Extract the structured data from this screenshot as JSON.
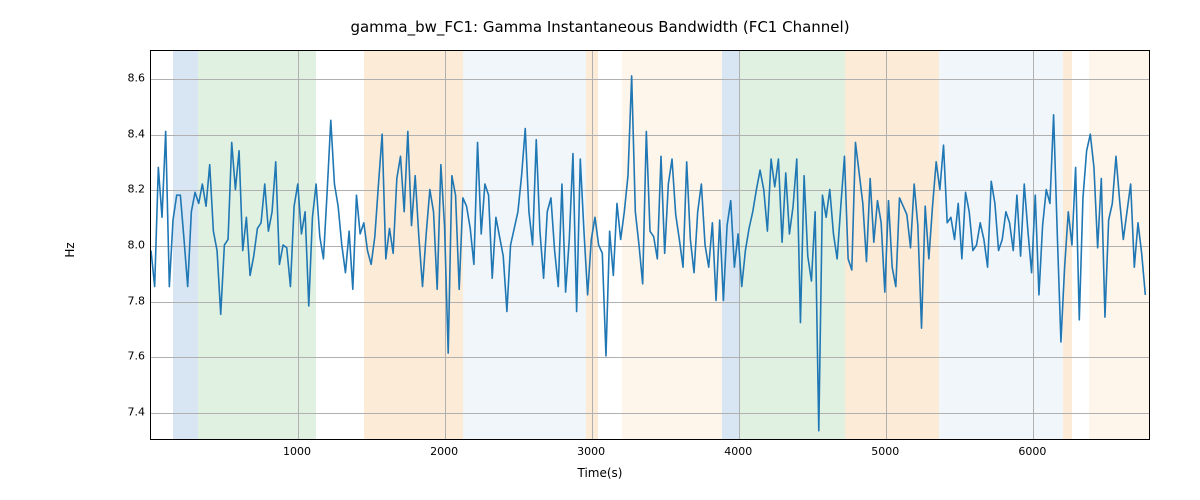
{
  "chart_data": {
    "type": "line",
    "title": "gamma_bw_FC1: Gamma Instantaneous Bandwidth (FC1 Channel)",
    "xlabel": "Time(s)",
    "ylabel": "Hz",
    "xlim": [
      0,
      6800
    ],
    "ylim": [
      7.3,
      8.7
    ],
    "xticks": [
      1000,
      2000,
      3000,
      4000,
      5000,
      6000
    ],
    "yticks": [
      7.4,
      7.6,
      7.8,
      8.0,
      8.2,
      8.4,
      8.6
    ],
    "line_color": "#1f77b4",
    "bands": [
      {
        "x0": 150,
        "x1": 320,
        "color": "#8db7d9"
      },
      {
        "x0": 320,
        "x1": 1120,
        "color": "#a8d8a8"
      },
      {
        "x0": 1450,
        "x1": 2120,
        "color": "#f5c58b"
      },
      {
        "x0": 2120,
        "x1": 2960,
        "color": "#d7e5f2"
      },
      {
        "x0": 2960,
        "x1": 3040,
        "color": "#f5c58b"
      },
      {
        "x0": 3200,
        "x1": 3880,
        "color": "#fbe2c5"
      },
      {
        "x0": 3880,
        "x1": 4000,
        "color": "#8db7d9"
      },
      {
        "x0": 4000,
        "x1": 4720,
        "color": "#a8d8a8"
      },
      {
        "x0": 4720,
        "x1": 5360,
        "color": "#f5c58b"
      },
      {
        "x0": 5360,
        "x1": 6200,
        "color": "#d7e5f2"
      },
      {
        "x0": 6200,
        "x1": 6260,
        "color": "#f5c58b"
      },
      {
        "x0": 6380,
        "x1": 6800,
        "color": "#fbe2c5"
      }
    ],
    "x": [
      0,
      25,
      50,
      75,
      100,
      125,
      150,
      175,
      200,
      225,
      250,
      275,
      300,
      325,
      350,
      375,
      400,
      425,
      450,
      475,
      500,
      525,
      550,
      575,
      600,
      625,
      650,
      675,
      700,
      725,
      750,
      775,
      800,
      825,
      850,
      875,
      900,
      925,
      950,
      975,
      1000,
      1025,
      1050,
      1075,
      1100,
      1125,
      1150,
      1175,
      1200,
      1225,
      1250,
      1275,
      1300,
      1325,
      1350,
      1375,
      1400,
      1425,
      1450,
      1475,
      1500,
      1525,
      1550,
      1575,
      1600,
      1625,
      1650,
      1675,
      1700,
      1725,
      1750,
      1775,
      1800,
      1825,
      1850,
      1875,
      1900,
      1925,
      1950,
      1975,
      2000,
      2025,
      2050,
      2075,
      2100,
      2125,
      2150,
      2175,
      2200,
      2225,
      2250,
      2275,
      2300,
      2325,
      2350,
      2375,
      2400,
      2425,
      2450,
      2475,
      2500,
      2525,
      2550,
      2575,
      2600,
      2625,
      2650,
      2675,
      2700,
      2725,
      2750,
      2775,
      2800,
      2825,
      2850,
      2875,
      2900,
      2925,
      2950,
      2975,
      3000,
      3025,
      3050,
      3075,
      3100,
      3125,
      3150,
      3175,
      3200,
      3225,
      3250,
      3275,
      3300,
      3325,
      3350,
      3375,
      3400,
      3425,
      3450,
      3475,
      3500,
      3525,
      3550,
      3575,
      3600,
      3625,
      3650,
      3675,
      3700,
      3725,
      3750,
      3775,
      3800,
      3825,
      3850,
      3875,
      3900,
      3925,
      3950,
      3975,
      4000,
      4025,
      4050,
      4075,
      4100,
      4125,
      4150,
      4175,
      4200,
      4225,
      4250,
      4275,
      4300,
      4325,
      4350,
      4375,
      4400,
      4425,
      4450,
      4475,
      4500,
      4525,
      4550,
      4575,
      4600,
      4625,
      4650,
      4675,
      4700,
      4725,
      4750,
      4775,
      4800,
      4825,
      4850,
      4875,
      4900,
      4925,
      4950,
      4975,
      5000,
      5025,
      5050,
      5075,
      5100,
      5125,
      5150,
      5175,
      5200,
      5225,
      5250,
      5275,
      5300,
      5325,
      5350,
      5375,
      5400,
      5425,
      5450,
      5475,
      5500,
      5525,
      5550,
      5575,
      5600,
      5625,
      5650,
      5675,
      5700,
      5725,
      5750,
      5775,
      5800,
      5825,
      5850,
      5875,
      5900,
      5925,
      5950,
      5975,
      6000,
      6025,
      6050,
      6075,
      6100,
      6125,
      6150,
      6175,
      6200,
      6225,
      6250,
      6275,
      6300,
      6325,
      6350,
      6375,
      6400,
      6425,
      6450,
      6475,
      6500,
      6525,
      6550,
      6575,
      6600,
      6625,
      6650,
      6675,
      6700,
      6725,
      6750,
      6775,
      6800
    ],
    "values": [
      7.98,
      7.85,
      8.28,
      8.1,
      8.41,
      7.85,
      8.09,
      8.18,
      8.18,
      8.02,
      7.85,
      8.12,
      8.19,
      8.15,
      8.22,
      8.14,
      8.29,
      8.05,
      7.98,
      7.75,
      8.0,
      8.02,
      8.37,
      8.2,
      8.34,
      7.98,
      8.1,
      7.89,
      7.96,
      8.06,
      8.08,
      8.22,
      8.05,
      8.12,
      8.3,
      7.93,
      8.0,
      7.99,
      7.85,
      8.14,
      8.22,
      8.04,
      8.12,
      7.78,
      8.1,
      8.22,
      8.03,
      7.95,
      8.19,
      8.45,
      8.22,
      8.14,
      8.0,
      7.9,
      8.05,
      7.84,
      8.18,
      8.04,
      8.08,
      7.98,
      7.93,
      8.03,
      8.22,
      8.4,
      7.95,
      8.06,
      7.97,
      8.24,
      8.32,
      8.12,
      8.41,
      8.07,
      8.25,
      8.03,
      7.85,
      8.04,
      8.2,
      8.12,
      7.84,
      8.29,
      8.07,
      7.61,
      8.25,
      8.18,
      7.84,
      8.17,
      8.14,
      8.06,
      7.93,
      8.37,
      8.04,
      8.22,
      8.18,
      7.88,
      8.1,
      8.03,
      7.96,
      7.76,
      8.0,
      8.06,
      8.12,
      8.25,
      8.42,
      8.12,
      8.0,
      8.38,
      8.05,
      7.88,
      8.12,
      8.17,
      7.98,
      7.85,
      8.22,
      7.83,
      8.02,
      8.33,
      7.76,
      8.31,
      8.05,
      7.82,
      8.02,
      8.1,
      8.0,
      7.97,
      7.6,
      8.05,
      7.89,
      8.15,
      8.02,
      8.12,
      8.25,
      8.61,
      8.12,
      8.0,
      7.86,
      8.41,
      8.05,
      8.03,
      7.95,
      8.32,
      7.97,
      8.22,
      8.31,
      8.11,
      8.02,
      7.92,
      8.3,
      8.02,
      7.9,
      8.12,
      8.22,
      8.0,
      7.92,
      8.08,
      7.8,
      8.09,
      7.8,
      8.07,
      8.16,
      7.92,
      8.04,
      7.85,
      7.98,
      8.06,
      8.12,
      8.2,
      8.27,
      8.2,
      8.05,
      8.31,
      8.21,
      8.31,
      8.01,
      8.26,
      8.04,
      8.14,
      8.31,
      7.72,
      8.25,
      7.96,
      7.87,
      8.12,
      7.33,
      8.18,
      8.1,
      8.2,
      8.04,
      7.95,
      8.14,
      8.32,
      7.95,
      7.91,
      8.37,
      8.26,
      8.15,
      7.94,
      8.24,
      8.01,
      8.16,
      8.08,
      7.83,
      8.16,
      7.92,
      7.85,
      8.17,
      8.14,
      8.11,
      7.99,
      8.22,
      8.07,
      7.7,
      8.14,
      7.95,
      8.14,
      8.3,
      8.2,
      8.36,
      8.08,
      8.1,
      8.02,
      8.15,
      7.95,
      8.19,
      8.12,
      7.98,
      8.0,
      8.08,
      8.02,
      7.92,
      8.23,
      8.15,
      7.98,
      8.02,
      8.12,
      8.08,
      7.98,
      8.18,
      7.96,
      8.22,
      8.05,
      7.9,
      8.18,
      7.82,
      8.07,
      8.2,
      8.15,
      8.47,
      8.04,
      7.65,
      7.92,
      8.12,
      8.0,
      8.28,
      7.73,
      8.17,
      8.34,
      8.4,
      8.28,
      7.99,
      8.24,
      7.74,
      8.09,
      8.15,
      8.32,
      8.16,
      8.02,
      8.12,
      8.22,
      7.92,
      8.08,
      7.97,
      7.82
    ]
  }
}
